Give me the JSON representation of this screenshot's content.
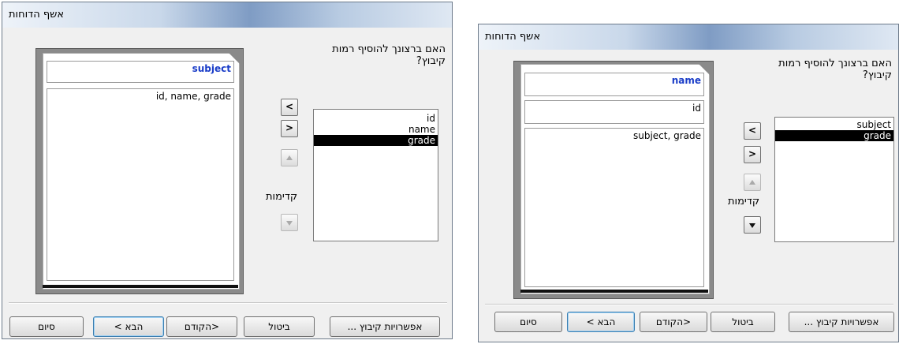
{
  "left_dialog": {
    "title": "אשף הדוחות",
    "question_line1": "האם ברצונך להוסיף רמות",
    "question_line2": "קיבוץ?",
    "preview": {
      "group1": "subject",
      "detail": "id, name, grade"
    },
    "fields_list": [
      {
        "label": "id",
        "selected": false
      },
      {
        "label": "name",
        "selected": false
      },
      {
        "label": "grade",
        "selected": true
      }
    ],
    "buttons": {
      "add": "<",
      "remove": ">",
      "priority_up": "▲",
      "priority_down": "▼",
      "priority_label": "קדימות",
      "grouping_options": "אפשרויות קיבוץ ...",
      "cancel": "ביטול",
      "back": "<הקודם",
      "next": "הבא >",
      "finish": "סיום"
    }
  },
  "right_dialog": {
    "title": "אשף הדוחות",
    "question_line1": "האם ברצונך להוסיף רמות",
    "question_line2": "קיבוץ?",
    "preview": {
      "group1": "name",
      "group2": "id",
      "detail": "subject, grade"
    },
    "fields_list": [
      {
        "label": "subject",
        "selected": false
      },
      {
        "label": "grade",
        "selected": true
      }
    ],
    "buttons": {
      "add": "<",
      "remove": ">",
      "priority_up": "▲",
      "priority_down": "▼",
      "priority_label": "קדימות",
      "grouping_options": "אפשרויות קיבוץ ...",
      "cancel": "ביטול",
      "back": "<הקודם",
      "next": "הבא >",
      "finish": "סיום"
    }
  }
}
